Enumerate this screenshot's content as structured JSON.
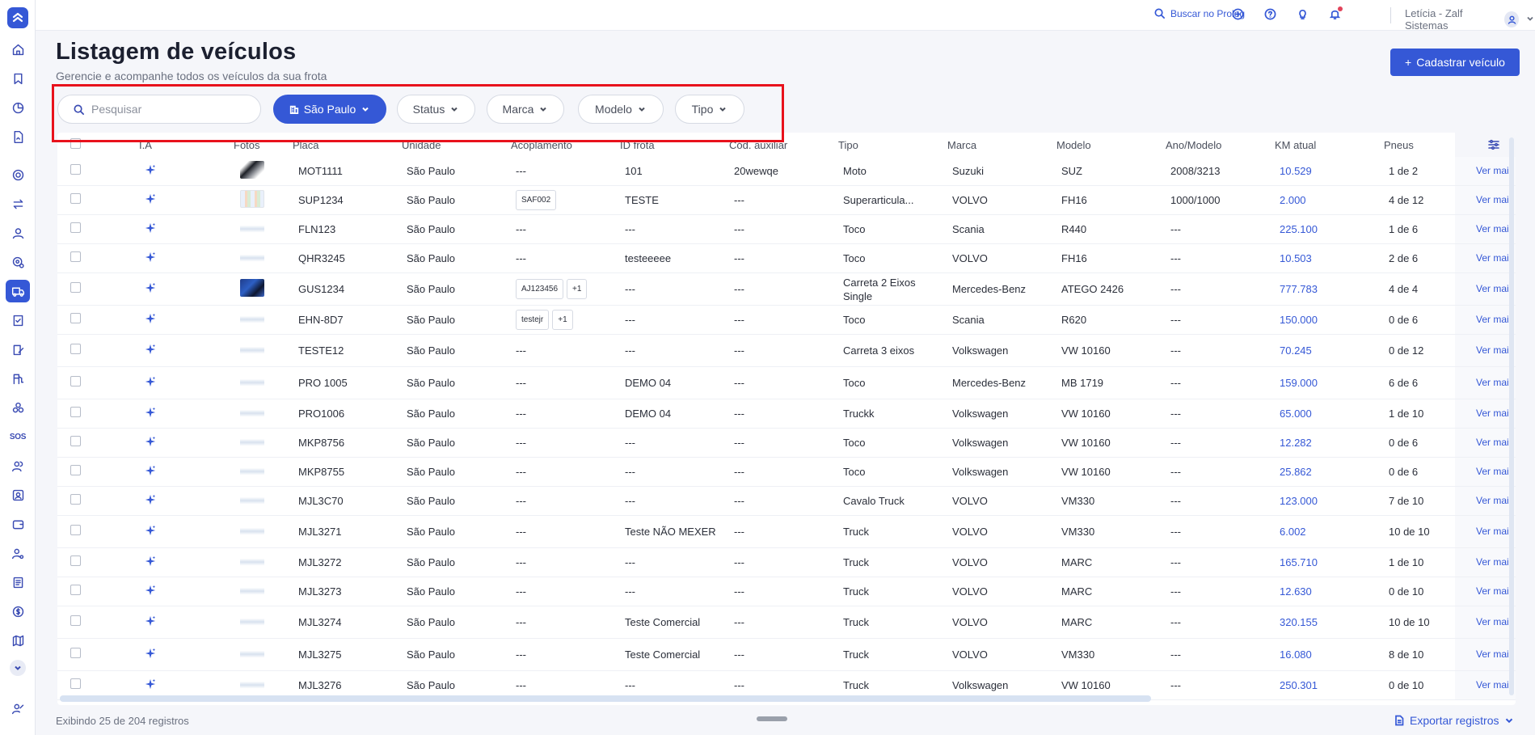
{
  "topbar": {
    "search_label": "Buscar no Prolog",
    "user_name": "Letícia - Zalf Sistemas"
  },
  "page": {
    "title": "Listagem de veículos",
    "subtitle": "Gerencie e acompanhe todos os veículos da sua frota",
    "add_button": "Cadastrar veículo"
  },
  "filters": {
    "search_placeholder": "Pesquisar",
    "unit": "São Paulo",
    "status": "Status",
    "brand": "Marca",
    "model": "Modelo",
    "type": "Tipo"
  },
  "table": {
    "headers": {
      "ia": "I.A",
      "fotos": "Fotos",
      "placa": "Placa",
      "unidade": "Unidade",
      "acoplamento": "Acoplamento",
      "id_frota": "ID frota",
      "cod_aux": "Cód. auxiliar",
      "tipo": "Tipo",
      "marca": "Marca",
      "modelo": "Modelo",
      "ano": "Ano/Modelo",
      "km": "KM atual",
      "pneus": "Pneus"
    },
    "action_label": "Ver mais",
    "rows": [
      {
        "photo": "moto",
        "placa": "MOT1111",
        "unidade": "São Paulo",
        "acop": [],
        "id_frota": "101",
        "cod": "20wewqe",
        "tipo": "Moto",
        "marca": "Suzuki",
        "modelo": "SUZ",
        "ano": "2008/3213",
        "km": "10.529",
        "pneus": "1 de 2"
      },
      {
        "photo": "doc",
        "placa": "SUP1234",
        "unidade": "São Paulo",
        "acop": [
          "SAF002"
        ],
        "id_frota": "TESTE",
        "cod": "---",
        "tipo": "Superarticula...",
        "marca": "VOLVO",
        "modelo": "FH16",
        "ano": "1000/1000",
        "km": "2.000",
        "pneus": "4 de 12"
      },
      {
        "photo": "blank",
        "placa": "FLN123",
        "unidade": "São Paulo",
        "acop": [],
        "id_frota": "---",
        "cod": "---",
        "tipo": "Toco",
        "marca": "Scania",
        "modelo": "R440",
        "ano": "---",
        "km": "225.100",
        "pneus": "1 de 6"
      },
      {
        "photo": "blank",
        "placa": "QHR3245",
        "unidade": "São Paulo",
        "acop": [],
        "id_frota": "testeeeee",
        "cod": "---",
        "tipo": "Toco",
        "marca": "VOLVO",
        "modelo": "FH16",
        "ano": "---",
        "km": "10.503",
        "pneus": "2 de 6"
      },
      {
        "photo": "blue",
        "placa": "GUS1234",
        "unidade": "São Paulo",
        "acop": [
          "AJ123456",
          "+1"
        ],
        "id_frota": "---",
        "cod": "---",
        "tipo": "Carreta 2 Eixos Single",
        "marca": "Mercedes-Benz",
        "modelo": "ATEGO 2426",
        "ano": "---",
        "km": "777.783",
        "pneus": "4 de 4"
      },
      {
        "photo": "blank",
        "placa": "EHN-8D7",
        "unidade": "São Paulo",
        "acop": [
          "testejr",
          "+1"
        ],
        "id_frota": "---",
        "cod": "---",
        "tipo": "Toco",
        "marca": "Scania",
        "modelo": "R620",
        "ano": "---",
        "km": "150.000",
        "pneus": "0 de 6"
      },
      {
        "photo": "blank",
        "placa": "TESTE12",
        "unidade": "São Paulo",
        "acop": [],
        "id_frota": "---",
        "cod": "---",
        "tipo": "Carreta 3 eixos",
        "marca": "Volkswagen",
        "modelo": "VW 10160",
        "ano": "---",
        "km": "70.245",
        "pneus": "0 de 12"
      },
      {
        "photo": "blank",
        "placa": "PRO 1005",
        "unidade": "São Paulo",
        "acop": [],
        "id_frota": "DEMO 04",
        "cod": "---",
        "tipo": "Toco",
        "marca": "Mercedes-Benz",
        "modelo": "MB 1719",
        "ano": "---",
        "km": "159.000",
        "pneus": "6 de 6"
      },
      {
        "photo": "blank",
        "placa": "PRO1006",
        "unidade": "São Paulo",
        "acop": [],
        "id_frota": "DEMO 04",
        "cod": "---",
        "tipo": "Truckk",
        "marca": "Volkswagen",
        "modelo": "VW 10160",
        "ano": "---",
        "km": "65.000",
        "pneus": "1 de 10"
      },
      {
        "photo": "blank",
        "placa": "MKP8756",
        "unidade": "São Paulo",
        "acop": [],
        "id_frota": "---",
        "cod": "---",
        "tipo": "Toco",
        "marca": "Volkswagen",
        "modelo": "VW 10160",
        "ano": "---",
        "km": "12.282",
        "pneus": "0 de 6"
      },
      {
        "photo": "blank",
        "placa": "MKP8755",
        "unidade": "São Paulo",
        "acop": [],
        "id_frota": "---",
        "cod": "---",
        "tipo": "Toco",
        "marca": "Volkswagen",
        "modelo": "VW 10160",
        "ano": "---",
        "km": "25.862",
        "pneus": "0 de 6"
      },
      {
        "photo": "blank",
        "placa": "MJL3C70",
        "unidade": "São Paulo",
        "acop": [],
        "id_frota": "---",
        "cod": "---",
        "tipo": "Cavalo Truck",
        "marca": "VOLVO",
        "modelo": "VM330",
        "ano": "---",
        "km": "123.000",
        "pneus": "7 de 10"
      },
      {
        "photo": "blank",
        "placa": "MJL3271",
        "unidade": "São Paulo",
        "acop": [],
        "id_frota": "Teste NÃO MEXER",
        "cod": "---",
        "tipo": "Truck",
        "marca": "VOLVO",
        "modelo": "VM330",
        "ano": "---",
        "km": "6.002",
        "pneus": "10 de 10"
      },
      {
        "photo": "blank",
        "placa": "MJL3272",
        "unidade": "São Paulo",
        "acop": [],
        "id_frota": "---",
        "cod": "---",
        "tipo": "Truck",
        "marca": "VOLVO",
        "modelo": "MARC",
        "ano": "---",
        "km": "165.710",
        "pneus": "1 de 10"
      },
      {
        "photo": "blank",
        "placa": "MJL3273",
        "unidade": "São Paulo",
        "acop": [],
        "id_frota": "---",
        "cod": "---",
        "tipo": "Truck",
        "marca": "VOLVO",
        "modelo": "MARC",
        "ano": "---",
        "km": "12.630",
        "pneus": "0 de 10"
      },
      {
        "photo": "blank",
        "placa": "MJL3274",
        "unidade": "São Paulo",
        "acop": [],
        "id_frota": "Teste Comercial",
        "cod": "---",
        "tipo": "Truck",
        "marca": "VOLVO",
        "modelo": "MARC",
        "ano": "---",
        "km": "320.155",
        "pneus": "10 de 10"
      },
      {
        "photo": "blank",
        "placa": "MJL3275",
        "unidade": "São Paulo",
        "acop": [],
        "id_frota": "Teste Comercial",
        "cod": "---",
        "tipo": "Truck",
        "marca": "VOLVO",
        "modelo": "VM330",
        "ano": "---",
        "km": "16.080",
        "pneus": "8 de 10"
      },
      {
        "photo": "blank",
        "placa": "MJL3276",
        "unidade": "São Paulo",
        "acop": [],
        "id_frota": "---",
        "cod": "---",
        "tipo": "Truck",
        "marca": "Volkswagen",
        "modelo": "VW 10160",
        "ano": "---",
        "km": "250.301",
        "pneus": "0 de 10"
      }
    ]
  },
  "footer": {
    "count": "Exibindo 25 de 204 registros",
    "export": "Exportar registros"
  }
}
